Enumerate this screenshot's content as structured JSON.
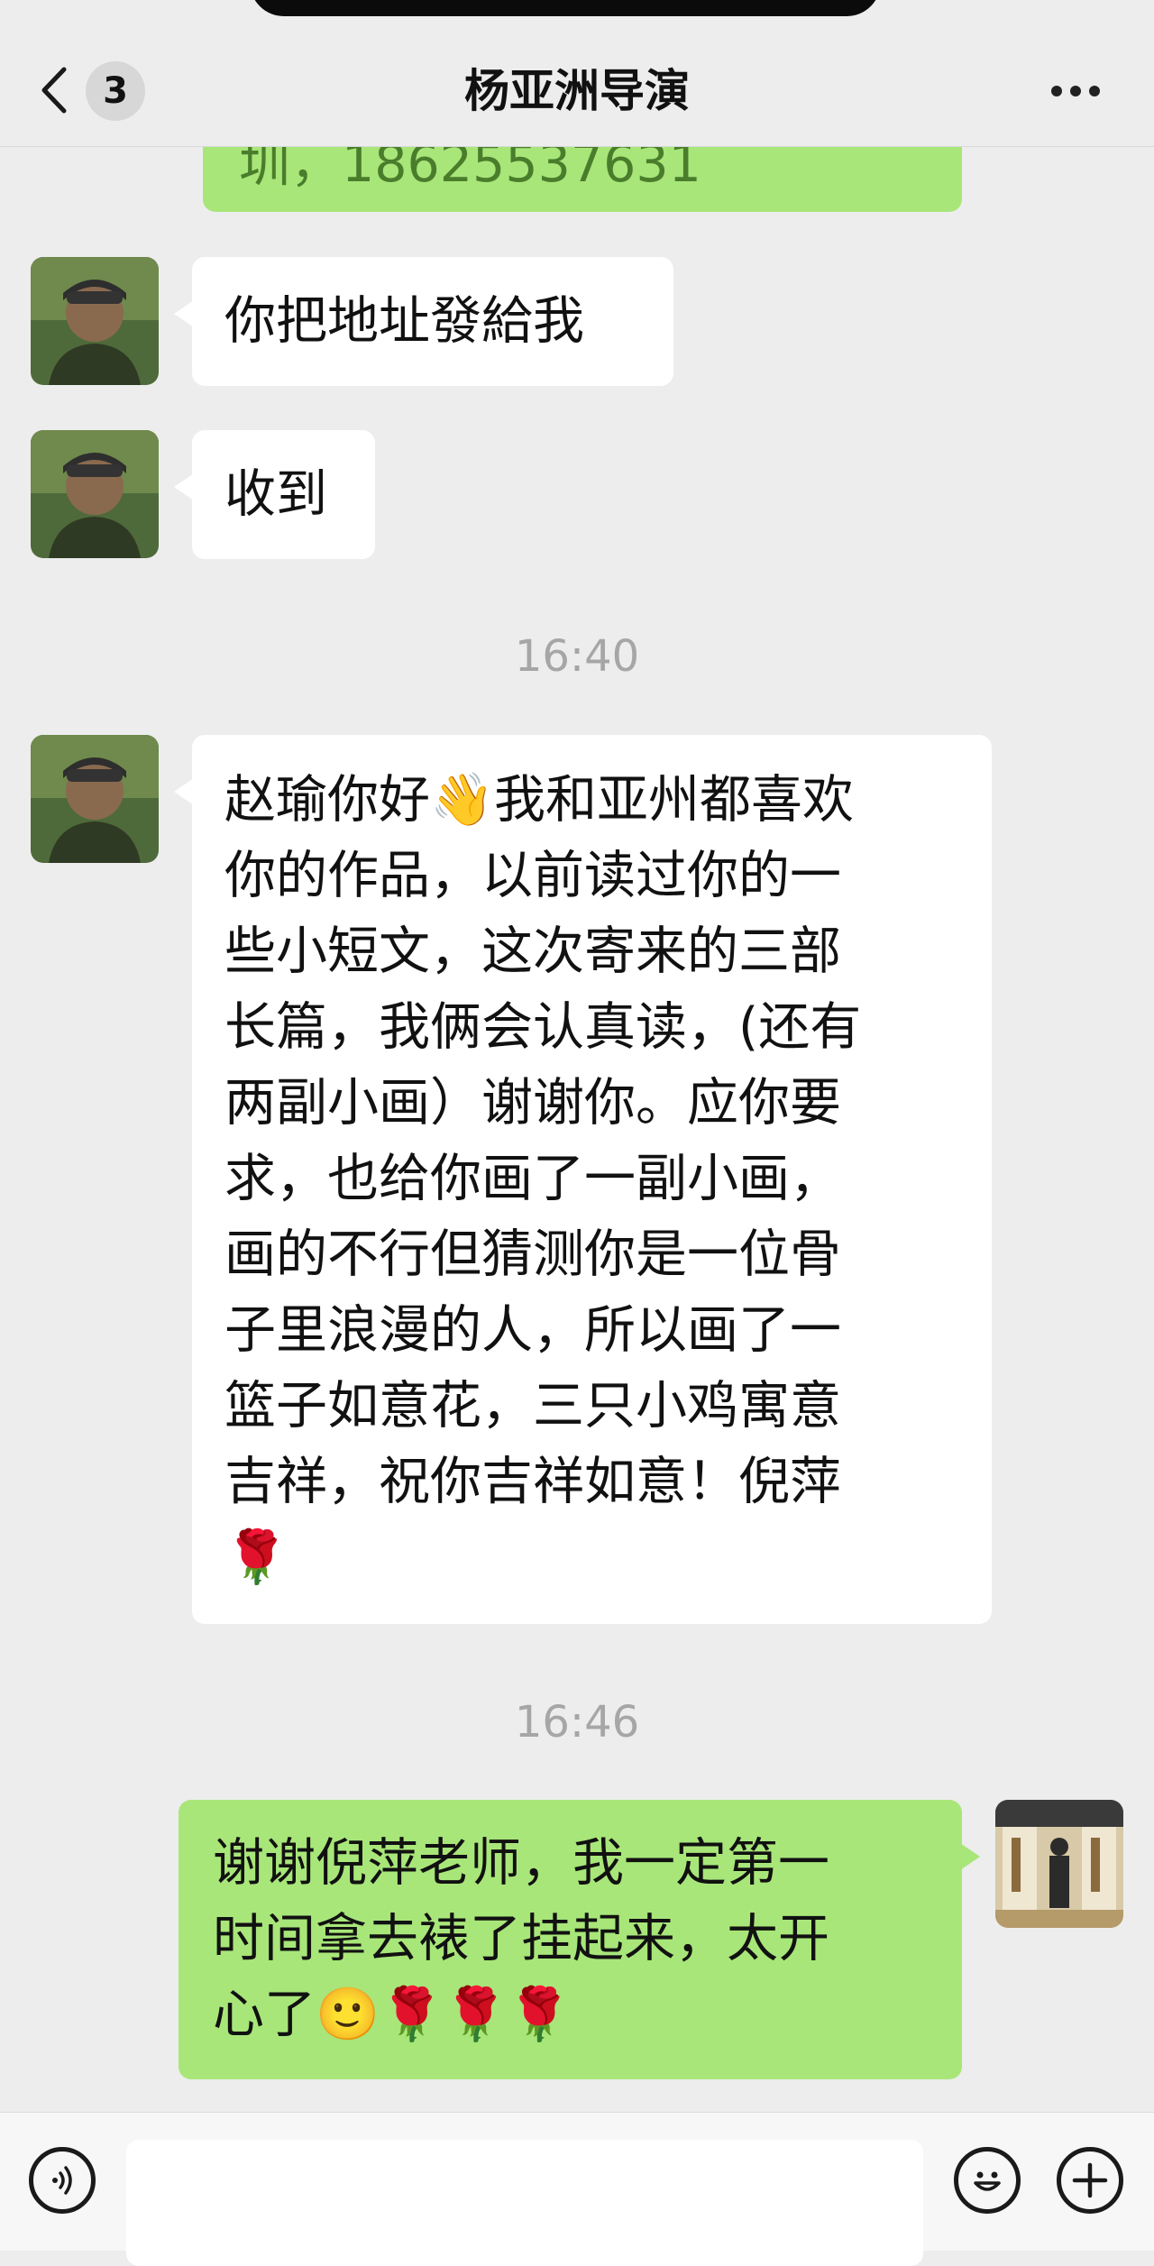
{
  "header": {
    "title": "杨亚洲导演",
    "unread_count": "3"
  },
  "messages": {
    "partial_top": "圳，18625537631",
    "m1": "你把地址發給我",
    "m2": "收到",
    "time1": "16:40",
    "m3_lines": [
      "赵瑜你好👋我和亚州都喜欢",
      "你的作品，以前读过你的一",
      "些小短文，这次寄来的三部",
      "长篇，我俩会认真读，(还有",
      "两副小画）谢谢你。应你要",
      "求，也给你画了一副小画，",
      "画的不行但猜测你是一位骨",
      "子里浪漫的人，所以画了一",
      "篮子如意花，三只小鸡寓意",
      "吉祥，祝你吉祥如意！倪萍",
      "🌹"
    ],
    "time2": "16:46",
    "m4_lines": [
      "谢谢倪萍老师，我一定第一",
      "时间拿去裱了挂起来，太开",
      "心了🙂🌹🌹🌹"
    ]
  },
  "icons": {
    "back": "chevron-left-icon",
    "more": "more-dots-icon",
    "voice": "voice-icon",
    "emoji": "emoji-icon",
    "plus": "plus-icon"
  },
  "colors": {
    "outgoing_bubble": "#a8e679",
    "incoming_bubble": "#ffffff",
    "background": "#ededed"
  }
}
